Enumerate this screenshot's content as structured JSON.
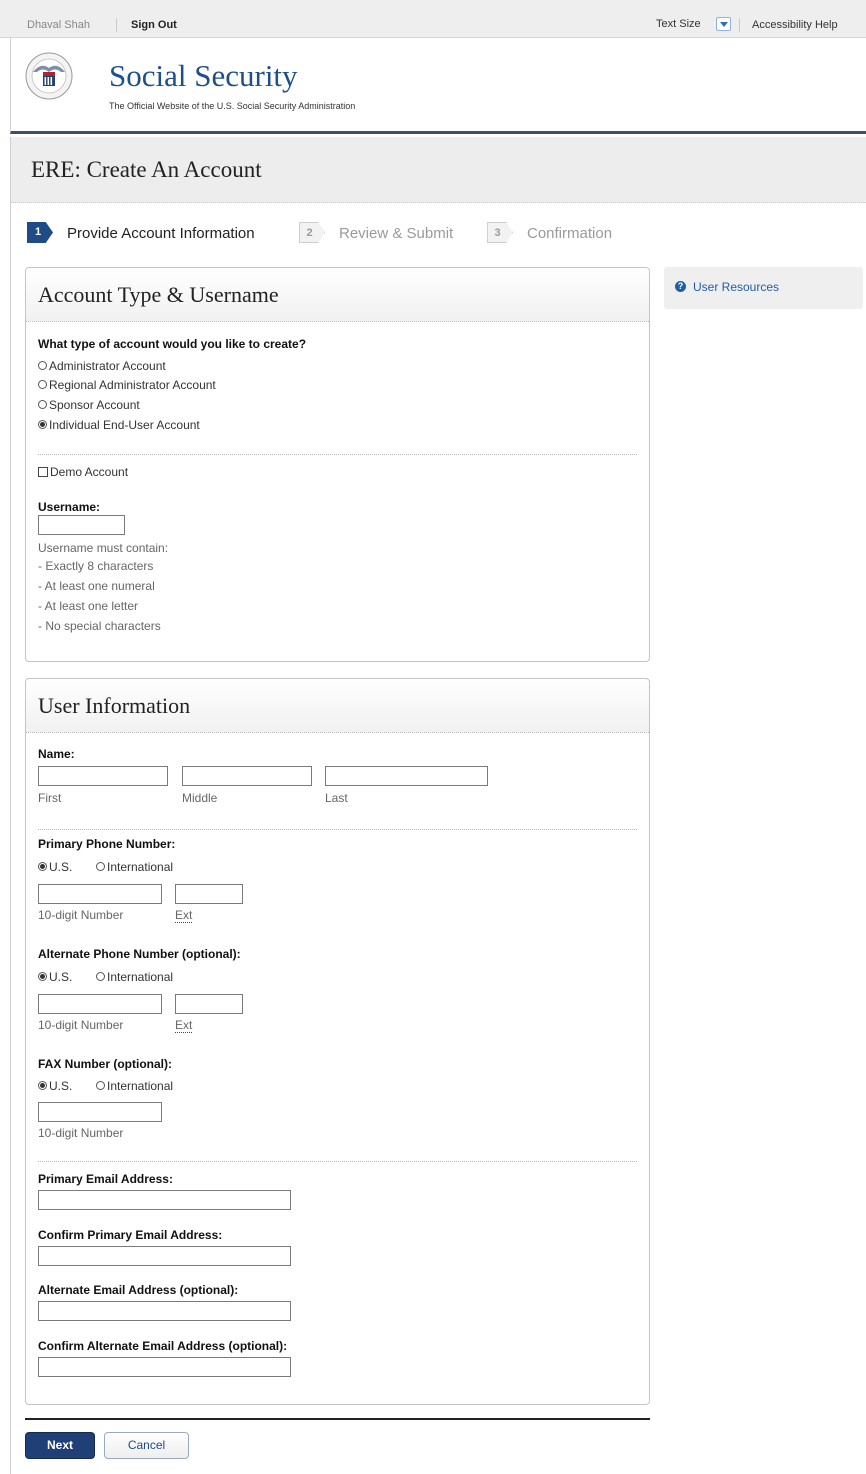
{
  "topbar": {
    "user_name": "Dhaval Shah",
    "sign_out": "Sign Out",
    "text_size": "Text Size",
    "accessibility_help": "Accessibility Help"
  },
  "header": {
    "brand": "Social Security",
    "tagline": "The Official Website of the U.S. Social Security Administration"
  },
  "page_title": "ERE: Create An Account",
  "steps": [
    {
      "number": "1",
      "label": "Provide Account Information",
      "state": "active"
    },
    {
      "number": "2",
      "label": "Review & Submit",
      "state": "inactive"
    },
    {
      "number": "3",
      "label": "Confirmation",
      "state": "inactive"
    }
  ],
  "account_panel": {
    "title": "Account Type & Username",
    "question": "What type of account would you like to create?",
    "account_types": [
      {
        "label": "Administrator Account",
        "checked": false
      },
      {
        "label": "Regional Administrator Account",
        "checked": false
      },
      {
        "label": "Sponsor Account",
        "checked": false
      },
      {
        "label": "Individual End-User Account",
        "checked": true
      }
    ],
    "demo_account": "Demo Account",
    "username_label": "Username:",
    "username_value": "",
    "rules_intro": "Username must contain:",
    "rules": [
      "- Exactly 8 characters",
      "- At least one numeral",
      "- At least one letter",
      "- No special characters"
    ]
  },
  "user_panel": {
    "title": "User Information",
    "name_label": "Name:",
    "name_parts": {
      "first": "First",
      "middle": "Middle",
      "last": "Last"
    },
    "primary_phone": {
      "label": "Primary Phone Number:",
      "us": "U.S.",
      "intl": "International",
      "number_hint": "10-digit Number",
      "ext_hint": "Ext"
    },
    "alternate_phone": {
      "label": "Alternate Phone Number (optional):",
      "us": "U.S.",
      "intl": "International",
      "number_hint": "10-digit Number",
      "ext_hint": "Ext"
    },
    "fax": {
      "label": "FAX Number (optional):",
      "us": "U.S.",
      "intl": "International",
      "number_hint": "10-digit Number"
    },
    "primary_email_label": "Primary Email Address:",
    "confirm_primary_email_label": "Confirm Primary Email Address:",
    "alternate_email_label": "Alternate Email Address (optional):",
    "confirm_alternate_email_label": "Confirm Alternate Email Address (optional):"
  },
  "sidebar": {
    "user_resources": "User Resources"
  },
  "buttons": {
    "next": "Next",
    "cancel": "Cancel"
  },
  "colors": {
    "brand_blue": "#1d4f8a",
    "header_rule": "#3c4f70",
    "next_button": "#1f3f76"
  }
}
